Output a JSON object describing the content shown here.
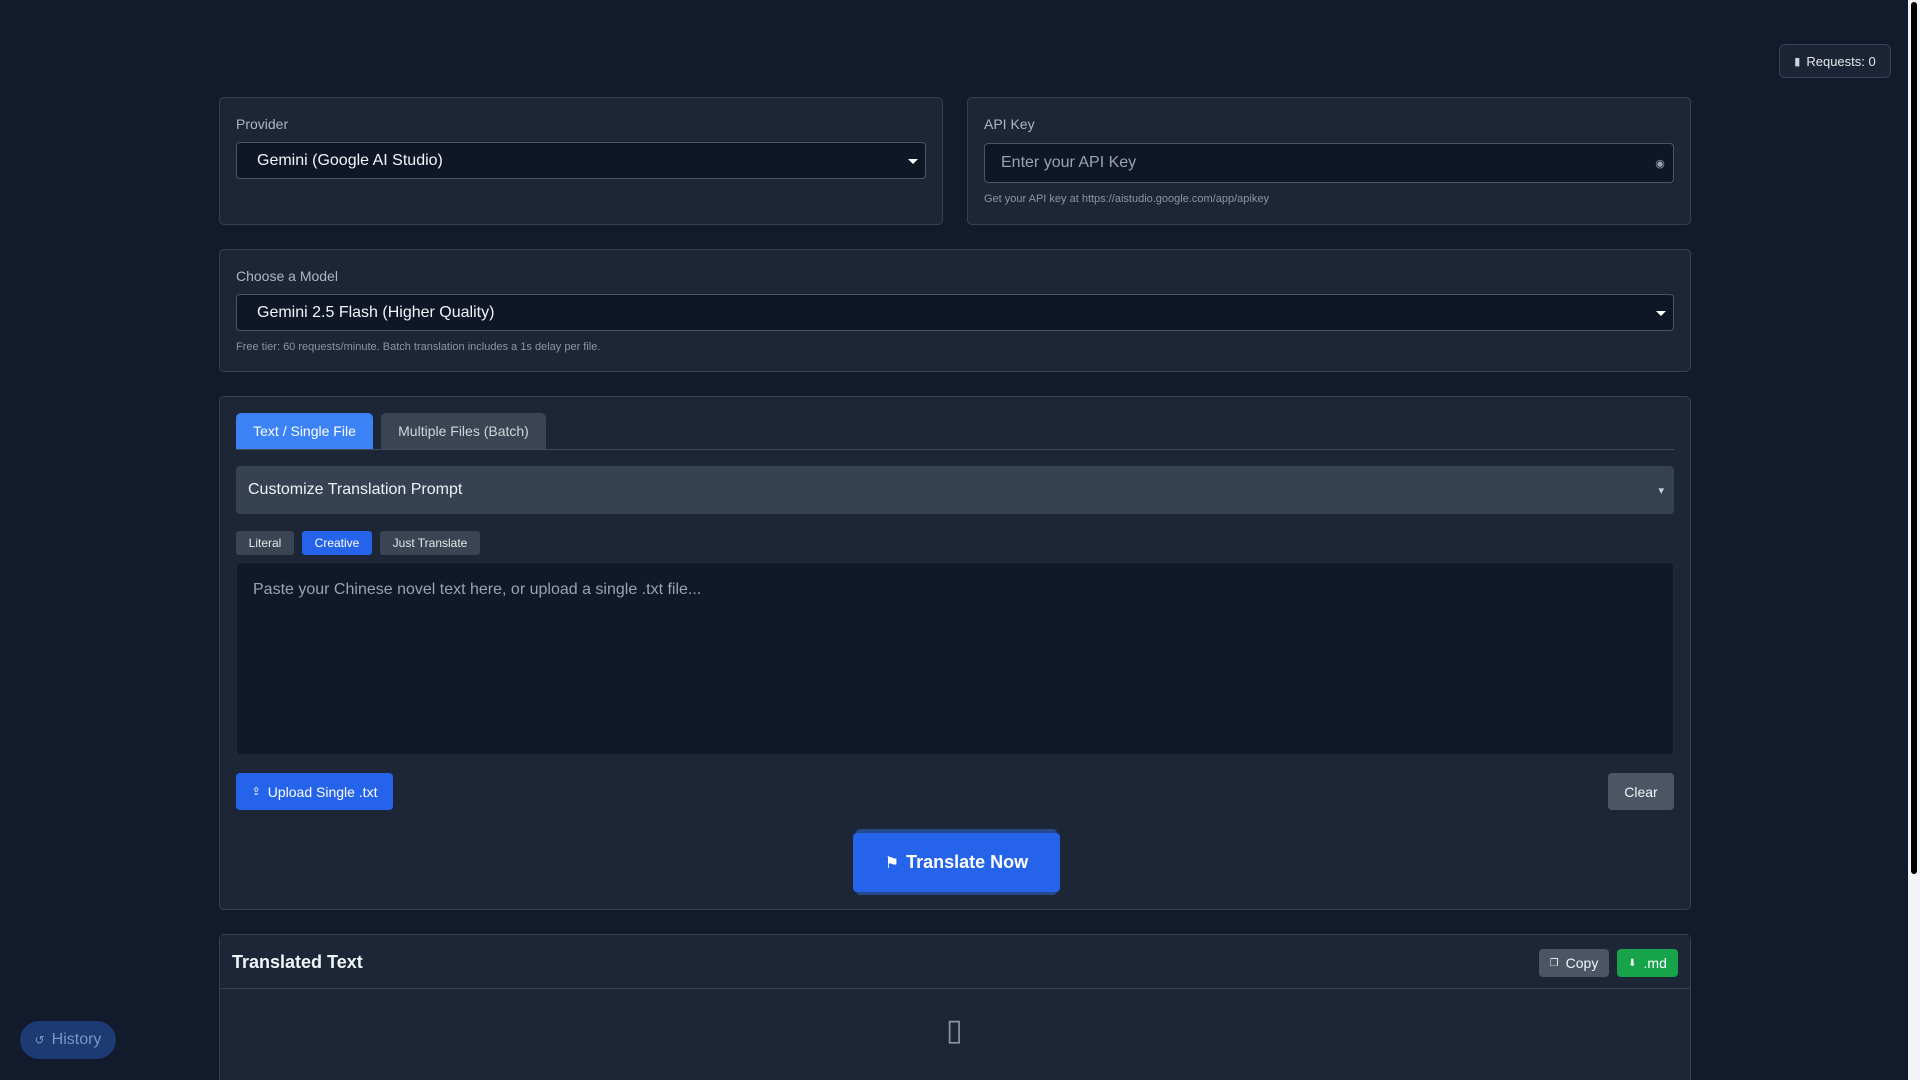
{
  "top_bar": {
    "requests_label": "Requests: 0",
    "requests_icon": "chart-bar-icon"
  },
  "provider": {
    "label": "Provider",
    "selected": "Gemini (Google AI Studio)"
  },
  "api_key": {
    "label": "API Key",
    "placeholder": "Enter your API Key",
    "value": "",
    "hint": "Get your API key at https://aistudio.google.com/app/apikey",
    "toggle_icon": "eye-icon"
  },
  "model": {
    "label": "Choose a Model",
    "selected": "Gemini 2.5 Flash (Higher Quality)",
    "hint": "Free tier: 60 requests/minute. Batch translation includes a 1s delay per file."
  },
  "tabs": [
    {
      "label": "Text / Single File",
      "active": true
    },
    {
      "label": "Multiple Files (Batch)",
      "active": false
    }
  ],
  "prompt_accordion": {
    "label": "Customize Translation Prompt",
    "chevron_icon": "chevron-down-icon"
  },
  "styles": [
    {
      "label": "Literal",
      "selected": false
    },
    {
      "label": "Creative",
      "selected": true
    },
    {
      "label": "Just Translate",
      "selected": false
    }
  ],
  "editor": {
    "placeholder": "Paste your Chinese novel text here, or upload a single .txt file...",
    "value": ""
  },
  "actions": {
    "upload_label": "Upload Single .txt",
    "upload_icon": "upload-icon",
    "clear_label": "Clear",
    "translate_label": "Translate Now",
    "translate_icon": "language-icon"
  },
  "result": {
    "title": "Translated Text",
    "copy_label": "Copy",
    "copy_icon": "copy-icon",
    "md_label": ".md",
    "md_icon": "markdown-download-icon",
    "empty_icon": "document-icon"
  },
  "history": {
    "label": "History",
    "icon": "history-icon"
  },
  "colors": {
    "background": "#121b2c",
    "panel": "#1d2637",
    "accent_blue": "#2563eb",
    "tab_blue": "#3b82f6",
    "success_green": "#16a34a"
  }
}
